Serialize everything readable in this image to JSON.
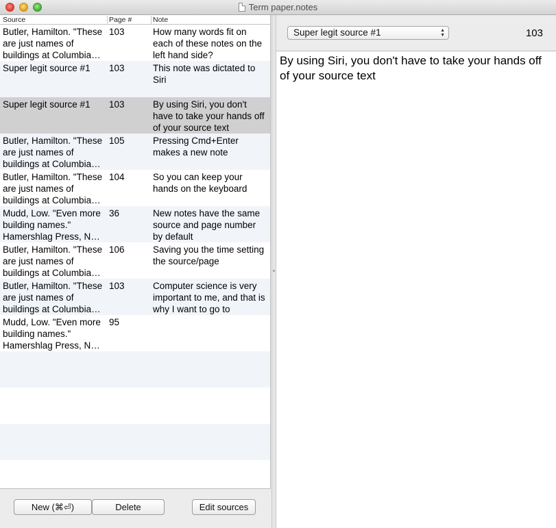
{
  "window": {
    "title": "Term paper.notes"
  },
  "table": {
    "columns": [
      "Source",
      "Page #",
      "Note"
    ],
    "rows": [
      {
        "source": "Butler, Hamilton. \"These are just names of buildings at Columbia University\"",
        "page": "103",
        "note": "How many words fit on each of these notes on the left hand side?"
      },
      {
        "source": "Super legit source #1",
        "page": "103",
        "note": "This note was dictated to Siri"
      },
      {
        "source": "Super legit source #1",
        "page": "103",
        "note": "By using Siri, you don't have to take your hands off of your source text"
      },
      {
        "source": "Butler, Hamilton. \"These are just names of buildings at Columbia University\"",
        "page": "105",
        "note": "Pressing Cmd+Enter makes a new note"
      },
      {
        "source": "Butler, Hamilton. \"These are just names of buildings at Columbia University\"",
        "page": "104",
        "note": "So you can keep your hands on the keyboard"
      },
      {
        "source": "Mudd, Low.  \"Even more building names.\" Hamershlag Press, New York",
        "page": "36",
        "note": "New notes have the same source and page number by default"
      },
      {
        "source": "Butler, Hamilton. \"These are just names of buildings at Columbia University\"",
        "page": "106",
        "note": "Saving you the time setting the source/page"
      },
      {
        "source": "Butler, Hamilton. \"These are just names of buildings at Columbia University\"",
        "page": "103",
        "note": "Computer science is very important to me, and that is why I want to go to"
      },
      {
        "source": "Mudd, Low.  \"Even more building names.\" Hamershlag Press, New York",
        "page": "95",
        "note": ""
      }
    ],
    "selected_index": 2
  },
  "buttons": {
    "new": "New (⌘⏎)",
    "delete": "Delete",
    "edit_sources": "Edit sources"
  },
  "detail": {
    "source_select": "Super legit source #1",
    "page": "103",
    "note_text": "By using Siri, you don't have to take your hands off of your source text"
  }
}
